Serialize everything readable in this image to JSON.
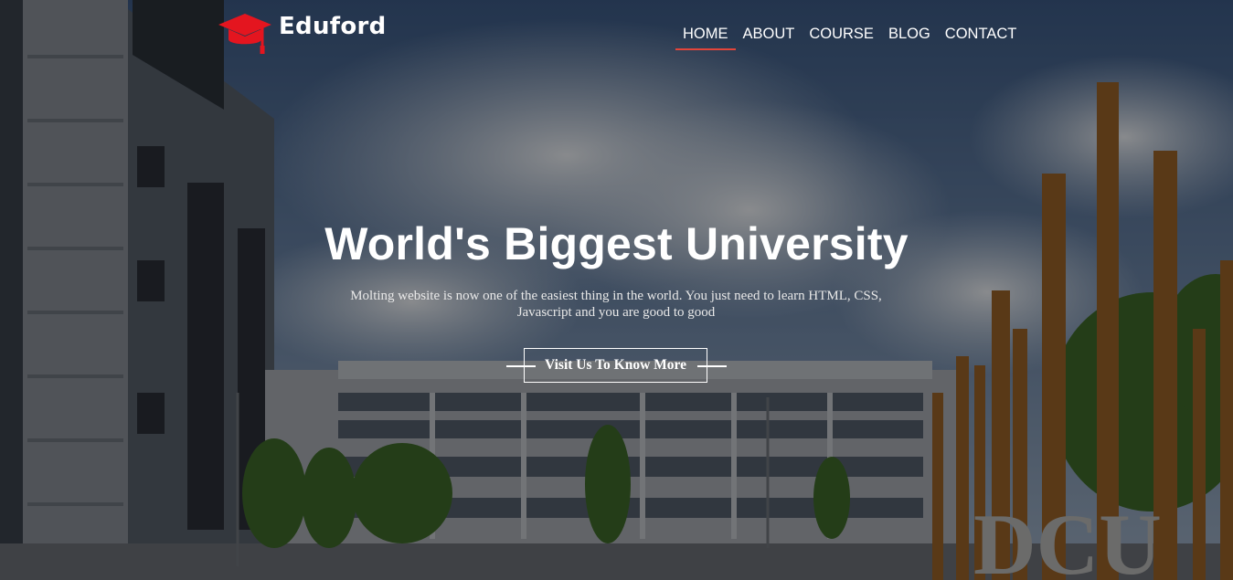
{
  "brand": {
    "name": "Eduford",
    "logo_icon": "graduation-cap-icon",
    "accent_color": "#e4151f"
  },
  "nav": {
    "items": [
      {
        "label": "HOME",
        "active": true
      },
      {
        "label": "ABOUT",
        "active": false
      },
      {
        "label": "COURSE",
        "active": false
      },
      {
        "label": "BLOG",
        "active": false
      },
      {
        "label": "CONTACT",
        "active": false
      }
    ],
    "active_underline_color": "#e4453a"
  },
  "hero": {
    "title": "World's Biggest University",
    "description": "Molting website is now one of the easiest thing in the world. You just need to learn HTML, CSS, Javascript and you are good to good",
    "cta_label": "Visit Us To Know More",
    "background_sign_text": "DCU"
  }
}
